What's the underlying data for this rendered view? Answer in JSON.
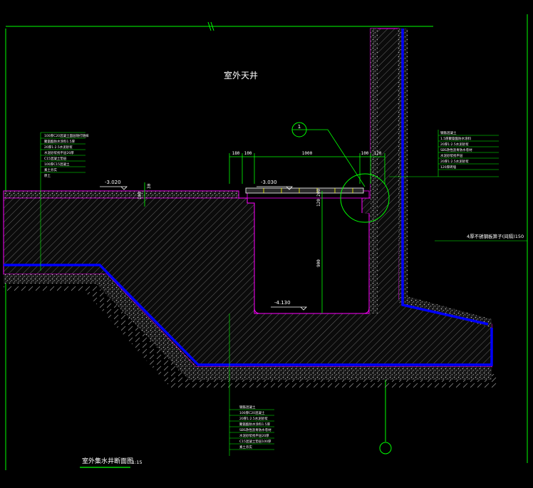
{
  "drawing": {
    "title": "室外天井",
    "section_title": "室外集水井断面图",
    "scale": "1:15",
    "section_mark": "1",
    "side_note": "4厚不锈钢板箅子(间隔)150"
  },
  "levels": {
    "left": "-3.020",
    "grate": "-3.030",
    "bottom": "-4.130"
  },
  "dimensions": {
    "top": [
      "180",
      "100",
      "1000",
      "100",
      "120"
    ],
    "vertical": [
      "100",
      "30",
      "120",
      "200",
      "900"
    ]
  },
  "notes": {
    "left": [
      "100厚C20混凝土面层随打随抹",
      "聚氨酯防水涂料1.5厚",
      "20厚1:2.5水泥砂浆",
      "水泥砂浆找平层20厚",
      "C15混凝土垫层",
      "100厚C15混凝土",
      "素土夯实",
      "原土"
    ],
    "right": [
      "钢筋混凝土",
      "1.5厚聚氨酯防水涂料",
      "20厚1:2.5水泥砂浆",
      "SBS改性沥青防水卷材",
      "水泥砂浆找平层",
      "20厚1:2.5水泥砂浆",
      "120厚砖墙"
    ],
    "bottom": [
      "钢筋混凝土",
      "100厚C20混凝土",
      "20厚1:2.5水泥砂浆",
      "聚氨酯防水涂料1.5厚",
      "SBS改性沥青防水卷材",
      "水泥砂浆找平层20厚",
      "C15混凝土垫层100厚",
      "素土夯实"
    ]
  },
  "colors": {
    "background": "#000000",
    "line_green": "#00ff00",
    "line_magenta": "#ff00ff",
    "membrane_blue": "#0000ff",
    "text_white": "#ffffff",
    "hatch_gray": "#8a8a8a"
  }
}
